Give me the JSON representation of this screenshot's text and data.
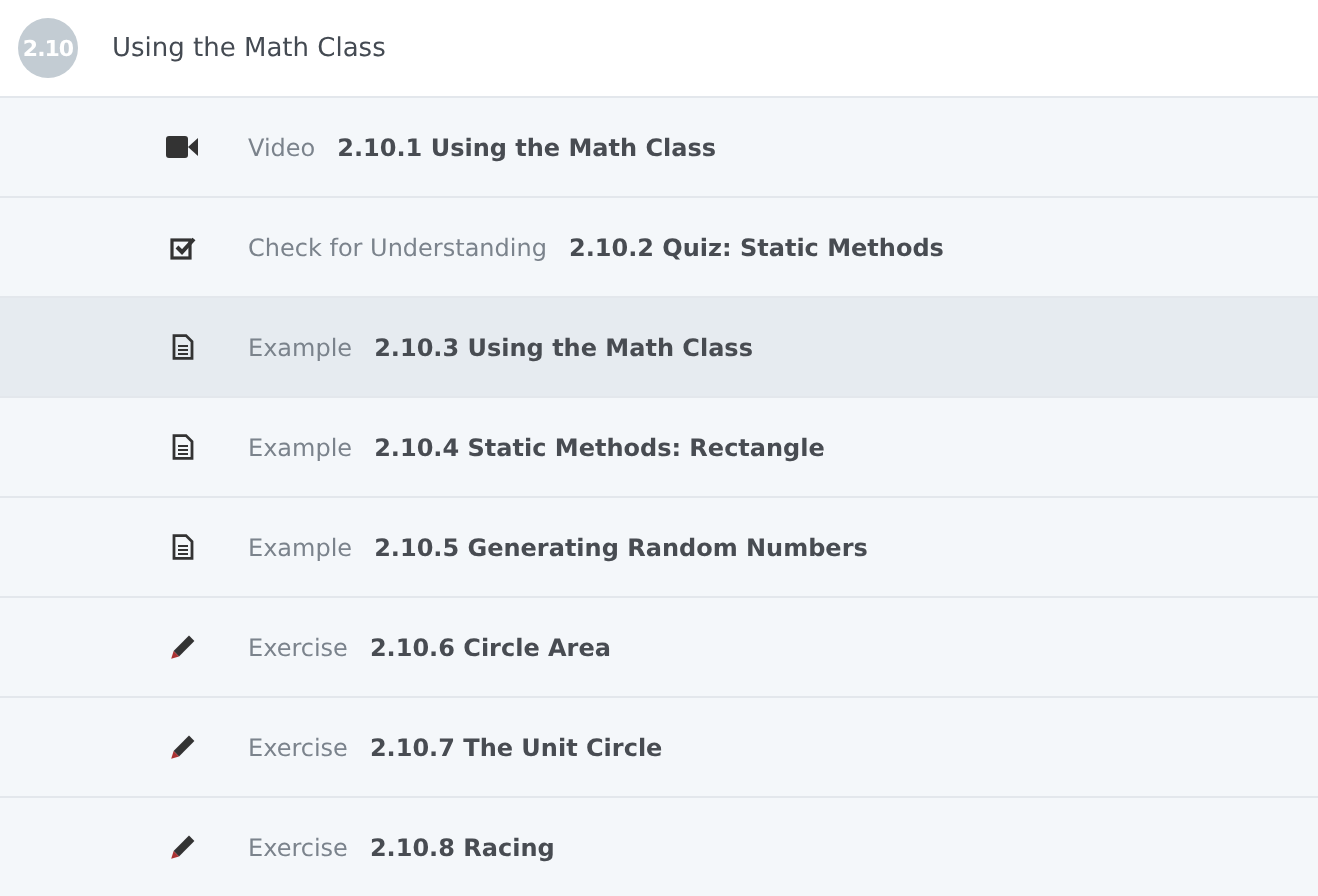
{
  "section": {
    "badge": "2.10",
    "title": "Using the Math Class"
  },
  "items": [
    {
      "kind": "video",
      "type": "Video",
      "title": "2.10.1 Using the Math Class",
      "selected": false
    },
    {
      "kind": "quiz",
      "type": "Check for Understanding",
      "title": "2.10.2 Quiz: Static Methods",
      "selected": false
    },
    {
      "kind": "example",
      "type": "Example",
      "title": "2.10.3 Using the Math Class",
      "selected": true
    },
    {
      "kind": "example",
      "type": "Example",
      "title": "2.10.4 Static Methods: Rectangle",
      "selected": false
    },
    {
      "kind": "example",
      "type": "Example",
      "title": "2.10.5 Generating Random Numbers",
      "selected": false
    },
    {
      "kind": "exercise",
      "type": "Exercise",
      "title": "2.10.6 Circle Area",
      "selected": false
    },
    {
      "kind": "exercise",
      "type": "Exercise",
      "title": "2.10.7 The Unit Circle",
      "selected": false
    },
    {
      "kind": "exercise",
      "type": "Exercise",
      "title": "2.10.8 Racing",
      "selected": false
    }
  ]
}
